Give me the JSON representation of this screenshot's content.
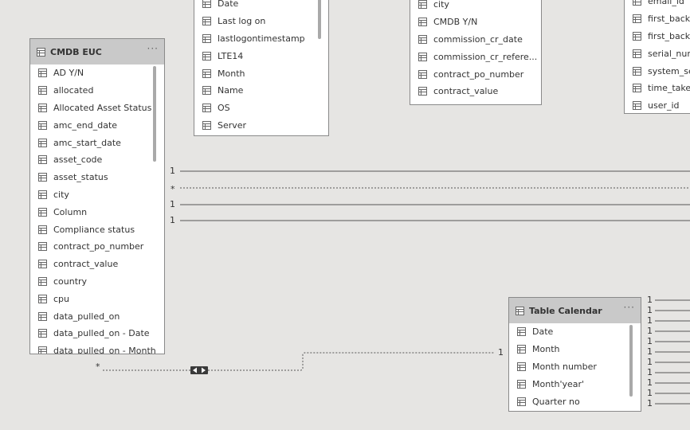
{
  "tables": {
    "cmdb_euc": {
      "title": "CMDB EUC",
      "more_icon": "ellipsis-icon",
      "fields": [
        "AD Y/N",
        "allocated",
        "Allocated Asset Status",
        "amc_end_date",
        "amc_start_date",
        "asset_code",
        "asset_status",
        "city",
        "Column",
        "Compliance status",
        "contract_po_number",
        "contract_value",
        "country",
        "cpu",
        "data_pulled_on",
        "data_pulled_on - Date",
        "data_pulled_on - Month"
      ]
    },
    "logon_table": {
      "fields": [
        "Date",
        "Last log on",
        "lastlogontimestamp",
        "LTE14",
        "Month",
        "Name",
        "OS",
        "Server"
      ]
    },
    "contract_table": {
      "fields": [
        "city",
        "CMDB Y/N",
        "commission_cr_date",
        "commission_cr_refere...",
        "contract_po_number",
        "contract_value"
      ]
    },
    "backup_table": {
      "fields": [
        "email_id",
        "first_backup",
        "first_backup",
        "serial_numb",
        "system_set",
        "time_taken",
        "user_id"
      ]
    },
    "table_calendar": {
      "title": "Table Calendar",
      "more_icon": "ellipsis-icon",
      "fields": [
        "Date",
        "Month",
        "Month number",
        "Month'year'",
        "Quarter no"
      ]
    }
  },
  "relationships": {
    "cardinality_labels": [
      "1",
      "*",
      "1",
      "1"
    ],
    "cmdb_calendar": {
      "from": "*",
      "to": "1",
      "direction_icon": "bidirectional-arrows-icon"
    },
    "calendar_right": [
      "1",
      "1",
      "1",
      "1",
      "1",
      "1",
      "1",
      "1",
      "1",
      "1",
      "1"
    ]
  },
  "colors": {
    "canvas": "#e6e5e3",
    "header": "#c9c9c9",
    "border": "#8a8a8a",
    "line": "#555555"
  }
}
